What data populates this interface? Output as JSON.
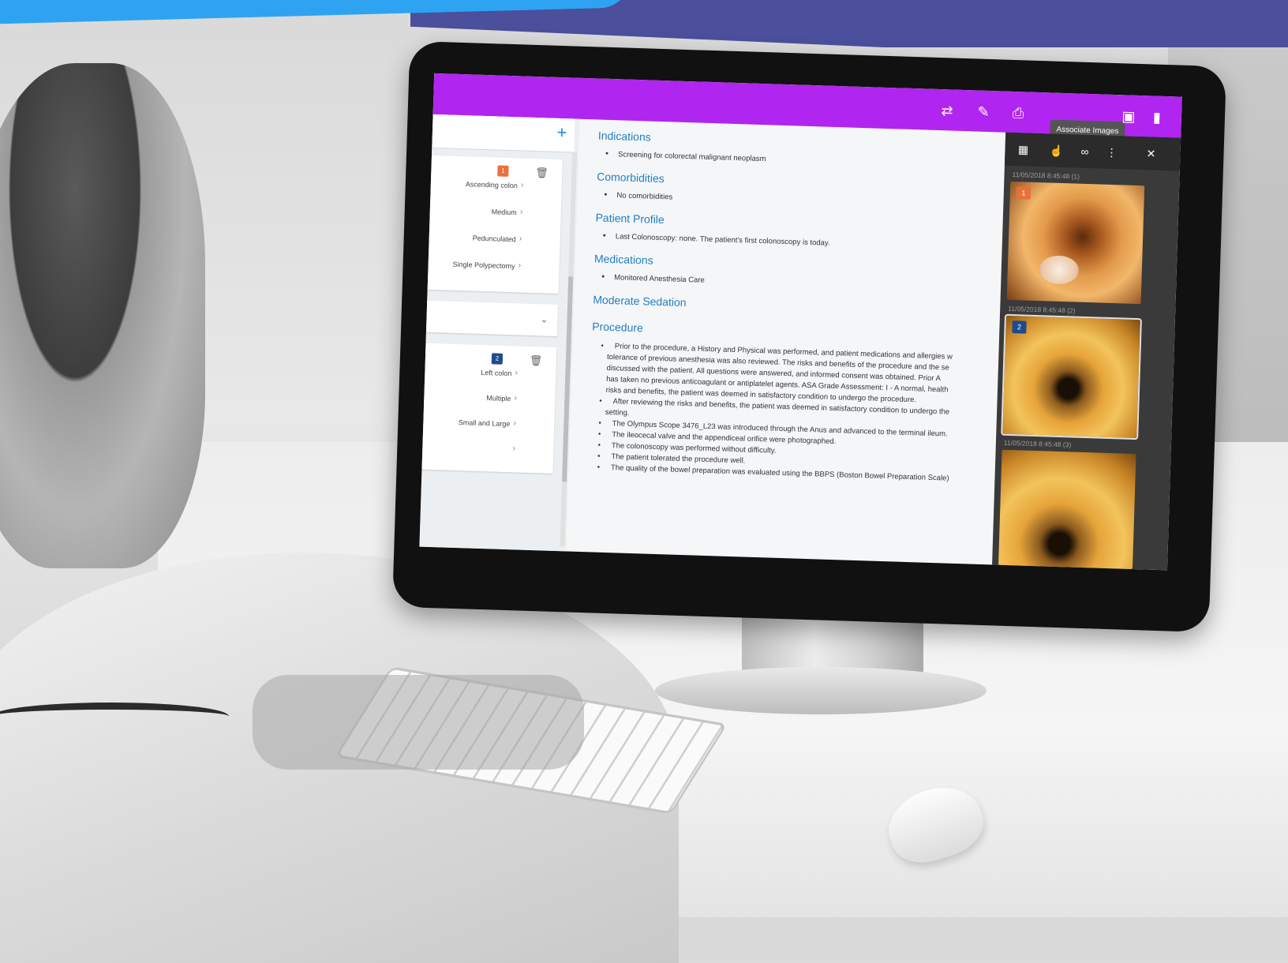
{
  "toolbar": {
    "associate_images_label": "Associate Images",
    "icons": [
      "compare-arrows-icon",
      "edit-icon",
      "print-icon",
      "images-icon",
      "bookmark-icon"
    ],
    "accent_color": "#b125f0"
  },
  "findings": {
    "add_symbol": "+",
    "cards": [
      {
        "badge": "1",
        "badge_color": "#e8703a",
        "rows": [
          "Ascending colon",
          "Medium",
          "Pedunculated",
          "Single Polypectomy"
        ]
      },
      {
        "badge": "2",
        "badge_color": "#1e4b8f",
        "rows": [
          "Left colon",
          "Multiple",
          "Small and Large",
          ""
        ]
      }
    ]
  },
  "report": {
    "sections": [
      {
        "title": "Indications",
        "bullets": [
          "Screening for colorectal malignant neoplasm"
        ]
      },
      {
        "title": "Comorbidities",
        "bullets": [
          "No comorbidities"
        ]
      },
      {
        "title": "Patient Profile",
        "bullets": [
          "Last Colonoscopy: none. The patient's first colonoscopy is today."
        ]
      },
      {
        "title": "Medications",
        "bullets": [
          "Monitored Anesthesia Care"
        ]
      },
      {
        "title": "Moderate Sedation",
        "bullets": []
      },
      {
        "title": "Procedure",
        "bullets": [
          "Prior to the procedure, a History and Physical was performed, and patient medications and allergies w",
          "tolerance of previous anesthesia was also reviewed.  The risks and benefits of the procedure and the se",
          "discussed with the patient.   All questions were answered, and informed consent was obtained.  Prior A",
          "has taken no previous anticoagulant or antiplatelet agents. ASA Grade Assessment: I - A normal, health",
          "risks and benefits, the patient was deemed in satisfactory condition to undergo the procedure.",
          "After reviewing the risks and benefits, the patient was deemed in satisfactory condition to undergo the",
          "setting.",
          "The Olympus Scope 3476_L23 was introduced through the Anus and advanced to the terminal ileum.",
          "The ileocecal valve and the appendiceal orifice were photographed.",
          "The colonoscopy was performed without difficulty.",
          "The patient tolerated the procedure well.",
          "The quality of the bowel preparation was evaluated using the BBPS (Boston Bowel Preparation Scale)"
        ]
      }
    ]
  },
  "viewer": {
    "icons": [
      "grid-icon",
      "cursor-hand-icon",
      "link-icon",
      "more-vert-icon",
      "close-icon"
    ],
    "images": [
      {
        "stamp": "11/05/2018 8:45:48 (1)",
        "num": "1",
        "num_color": "#e8703a"
      },
      {
        "stamp": "11/05/2018 8:45:48 (2)",
        "num": "2",
        "num_color": "#1e4b8f"
      },
      {
        "stamp": "11/05/2018 8:45:48 (3)",
        "num": "",
        "num_color": ""
      }
    ]
  }
}
